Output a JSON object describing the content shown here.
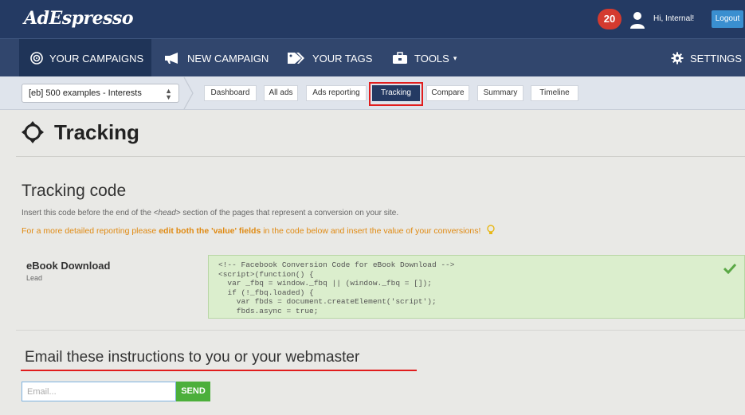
{
  "brand": {
    "logo": "AdEspresso"
  },
  "header": {
    "notification_count": "20",
    "greeting": "Hi, Internal!",
    "logout_label": "Logout"
  },
  "nav": {
    "items": [
      {
        "label": "YOUR CAMPAIGNS",
        "icon": "target-icon"
      },
      {
        "label": "NEW CAMPAIGN",
        "icon": "megaphone-icon"
      },
      {
        "label": "YOUR TAGS",
        "icon": "tag-icon"
      },
      {
        "label": "TOOLS",
        "icon": "toolbox-icon"
      },
      {
        "label": "SETTINGS",
        "icon": "gear-icon"
      }
    ]
  },
  "subnav": {
    "campaign_select": "[eb] 500 examples - Interests",
    "tabs": [
      "Dashboard",
      "All ads",
      "Ads reporting",
      "Tracking",
      "Compare",
      "Summary",
      "Timeline"
    ],
    "active_tab": "Tracking"
  },
  "page": {
    "title": "Tracking",
    "section_title": "Tracking code",
    "instruction_prefix": "Insert this code before the end of the ",
    "instruction_tag": "<head>",
    "instruction_suffix": " section of the pages that represent a conversion on your site.",
    "tip_prefix": "For a more detailed reporting please ",
    "tip_bold": "edit both the 'value' fields",
    "tip_suffix": " in the code below and insert the value of your conversions!"
  },
  "conversion": {
    "name": "eBook Download",
    "type": "Lead",
    "code": "<!-- Facebook Conversion Code for eBook Download -->\n<script>(function() {\n  var _fbq = window._fbq || (window._fbq = []);\n  if (!_fbq.loaded) {\n    var fbds = document.createElement('script');\n    fbds.async = true;"
  },
  "email": {
    "heading": "Email these instructions to you or your webmaster",
    "placeholder": "Email...",
    "send_label": "SEND"
  },
  "colors": {
    "topbar": "#243a63",
    "nav": "#31466d",
    "highlight": "#e11d1d",
    "tip": "#e08a12",
    "send": "#4caf3b"
  }
}
